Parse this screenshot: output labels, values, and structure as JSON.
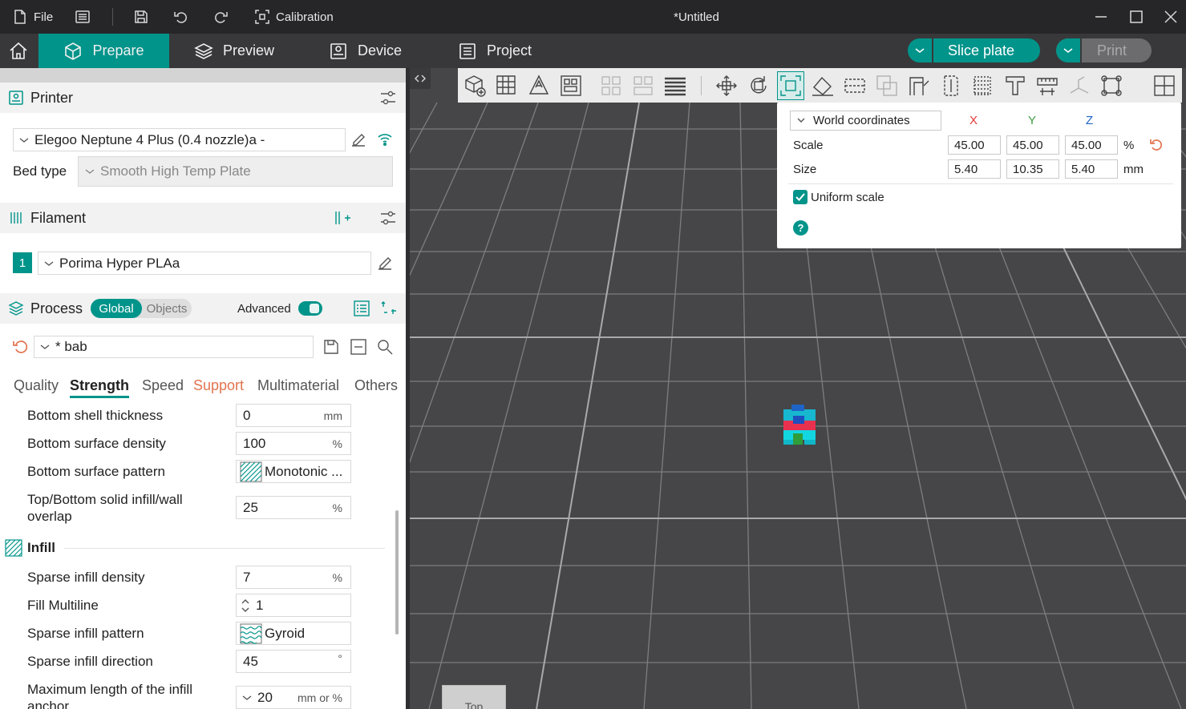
{
  "titlebar": {
    "file_label": "File",
    "calibration_label": "Calibration",
    "doc_title": "*Untitled"
  },
  "tabs": {
    "prepare": "Prepare",
    "preview": "Preview",
    "device": "Device",
    "project": "Project"
  },
  "actions": {
    "slice_label": "Slice plate",
    "print_label": "Print"
  },
  "printer": {
    "header": "Printer",
    "name": "Elegoo Neptune 4 Plus (0.4 nozzle)a -",
    "bed_type_label": "Bed type",
    "bed_type_value": "Smooth High Temp Plate"
  },
  "filament": {
    "header": "Filament",
    "slot_number": "1",
    "name": "Porima Hyper PLAa"
  },
  "process": {
    "header": "Process",
    "toggle_global": "Global",
    "toggle_objects": "Objects",
    "advanced_label": "Advanced",
    "preset_name": "* bab",
    "tabs": [
      "Quality",
      "Strength",
      "Speed",
      "Support",
      "Multimaterial",
      "Others"
    ],
    "active_tab": "Strength"
  },
  "settings": {
    "bottom_shell_thickness": {
      "label": "Bottom shell thickness",
      "value": "0",
      "unit": "mm"
    },
    "bottom_surface_density": {
      "label": "Bottom surface density",
      "value": "100",
      "unit": "%"
    },
    "bottom_surface_pattern": {
      "label": "Bottom surface pattern",
      "value": "Monotonic ..."
    },
    "top_bottom_overlap": {
      "label_line1": "Top/Bottom solid infill/wall",
      "label_line2": "overlap",
      "value": "25",
      "unit": "%"
    },
    "infill_header": "Infill",
    "sparse_infill_density": {
      "label": "Sparse infill density",
      "value": "7",
      "unit": "%"
    },
    "fill_multiline": {
      "label": "Fill Multiline",
      "value": "1"
    },
    "sparse_infill_pattern": {
      "label": "Sparse infill pattern",
      "value": "Gyroid"
    },
    "sparse_infill_direction": {
      "label": "Sparse infill direction",
      "value": "45",
      "unit": "°"
    },
    "max_infill_anchor": {
      "label_line1": "Maximum length of the infill",
      "label_line2": "anchor",
      "value": "20",
      "unit": "mm or %"
    }
  },
  "scale_panel": {
    "coords_label": "World coordinates",
    "axis_x": "X",
    "axis_y": "Y",
    "axis_z": "Z",
    "scale_label": "Scale",
    "scale_x": "45.00",
    "scale_y": "45.00",
    "scale_z": "45.00",
    "scale_unit": "%",
    "size_label": "Size",
    "size_x": "5.40",
    "size_y": "10.35",
    "size_z": "5.40",
    "size_unit": "mm",
    "uniform_label": "Uniform scale",
    "uniform_checked": true,
    "help_glyph": "?"
  },
  "viewport": {
    "view_cube_label": "Top"
  },
  "colors": {
    "accent": "#00948a",
    "support_tab": "#e2734f",
    "axis_x": "#e53935",
    "axis_y": "#43a047",
    "axis_z": "#1e63c6"
  }
}
